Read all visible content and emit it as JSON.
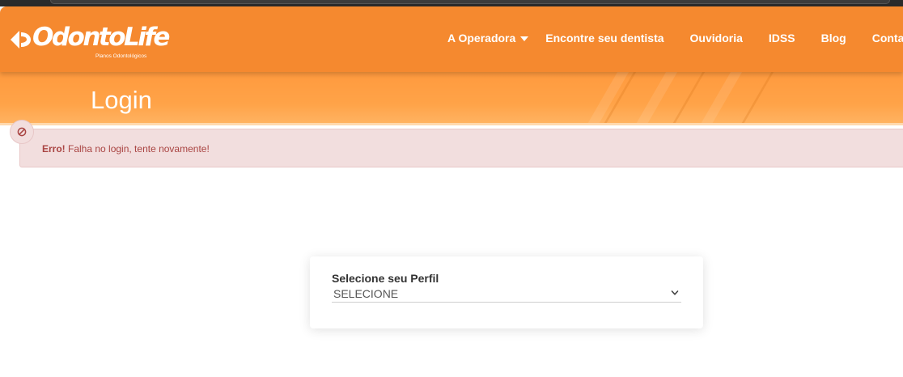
{
  "brand": {
    "name": "OdontoLife",
    "tagline": "Planos Odontológicos",
    "registered_mark": "®"
  },
  "nav": {
    "items": [
      {
        "label": "A Operadora",
        "has_dropdown": true
      },
      {
        "label": "Encontre seu dentista"
      },
      {
        "label": "Ouvidoria"
      },
      {
        "label": "IDSS"
      },
      {
        "label": "Blog"
      },
      {
        "label": "Contato"
      }
    ]
  },
  "banner": {
    "title": "Login"
  },
  "alert": {
    "icon": "ban-icon",
    "strong": "Erro!",
    "message": " Falha no login, tente novamente!"
  },
  "profile_form": {
    "label": "Selecione seu Perfil",
    "select_value": "SELECIONE",
    "chevron_icon": "chevron-down-icon"
  },
  "colors": {
    "brand_orange": "#f5892f",
    "banner_orange": "#ffa348",
    "alert_bg": "#f2dede",
    "alert_text": "#a94442"
  }
}
